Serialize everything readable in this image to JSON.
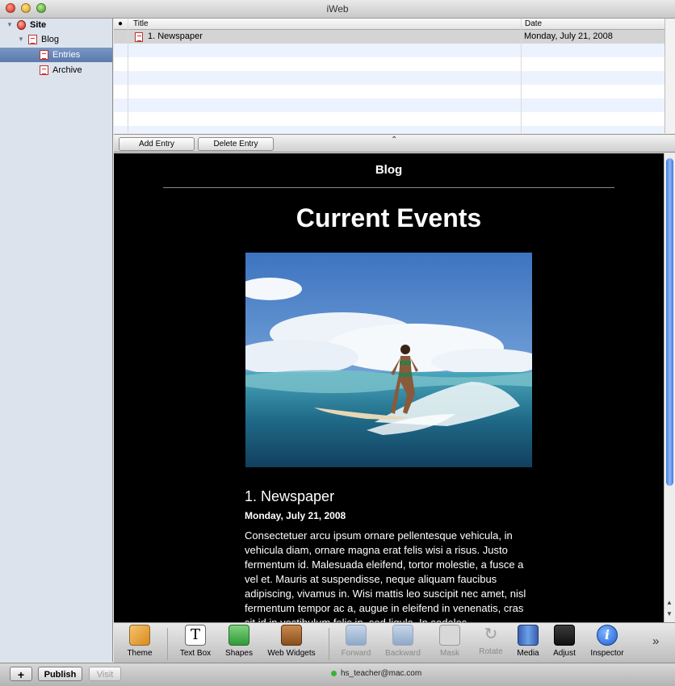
{
  "window": {
    "title": "iWeb"
  },
  "sidebar": {
    "items": [
      {
        "label": "Site"
      },
      {
        "label": "Blog"
      },
      {
        "label": "Entries"
      },
      {
        "label": "Archive"
      }
    ]
  },
  "entries_table": {
    "columns": [
      "Title",
      "Date"
    ],
    "rows": [
      {
        "title": "1. Newspaper",
        "date": "Monday, July 21, 2008"
      }
    ]
  },
  "entry_bar": {
    "add_label": "Add Entry",
    "delete_label": "Delete Entry",
    "caret": "⌃"
  },
  "page": {
    "blog_heading": "Blog",
    "title": "Current Events",
    "entry_title": "1. Newspaper",
    "entry_date": "Monday, July 21, 2008",
    "entry_body": "Consectetuer arcu ipsum ornare pellentesque vehicula, in vehicula diam, ornare magna erat felis wisi a risus. Justo fermentum id. Malesuada eleifend, tortor molestie, a fusce a vel et. Mauris at suspendisse, neque aliquam faucibus adipiscing, vivamus in. Wisi mattis leo suscipit nec amet, nisl fermentum tempor ac a, augue in eleifend in venenatis, cras sit id in vestibulum felis in, sed ligula. In sodales"
  },
  "toolbar": {
    "theme": "Theme",
    "text_box": "Text Box",
    "shapes": "Shapes",
    "web_widgets": "Web Widgets",
    "forward": "Forward",
    "backward": "Backward",
    "mask": "Mask",
    "rotate": "Rotate",
    "media": "Media",
    "adjust": "Adjust",
    "inspector": "Inspector",
    "overflow": "»"
  },
  "bottom_bar": {
    "add": "+",
    "publish": "Publish",
    "visit": "Visit",
    "account": "hs_teacher@mac.com"
  }
}
